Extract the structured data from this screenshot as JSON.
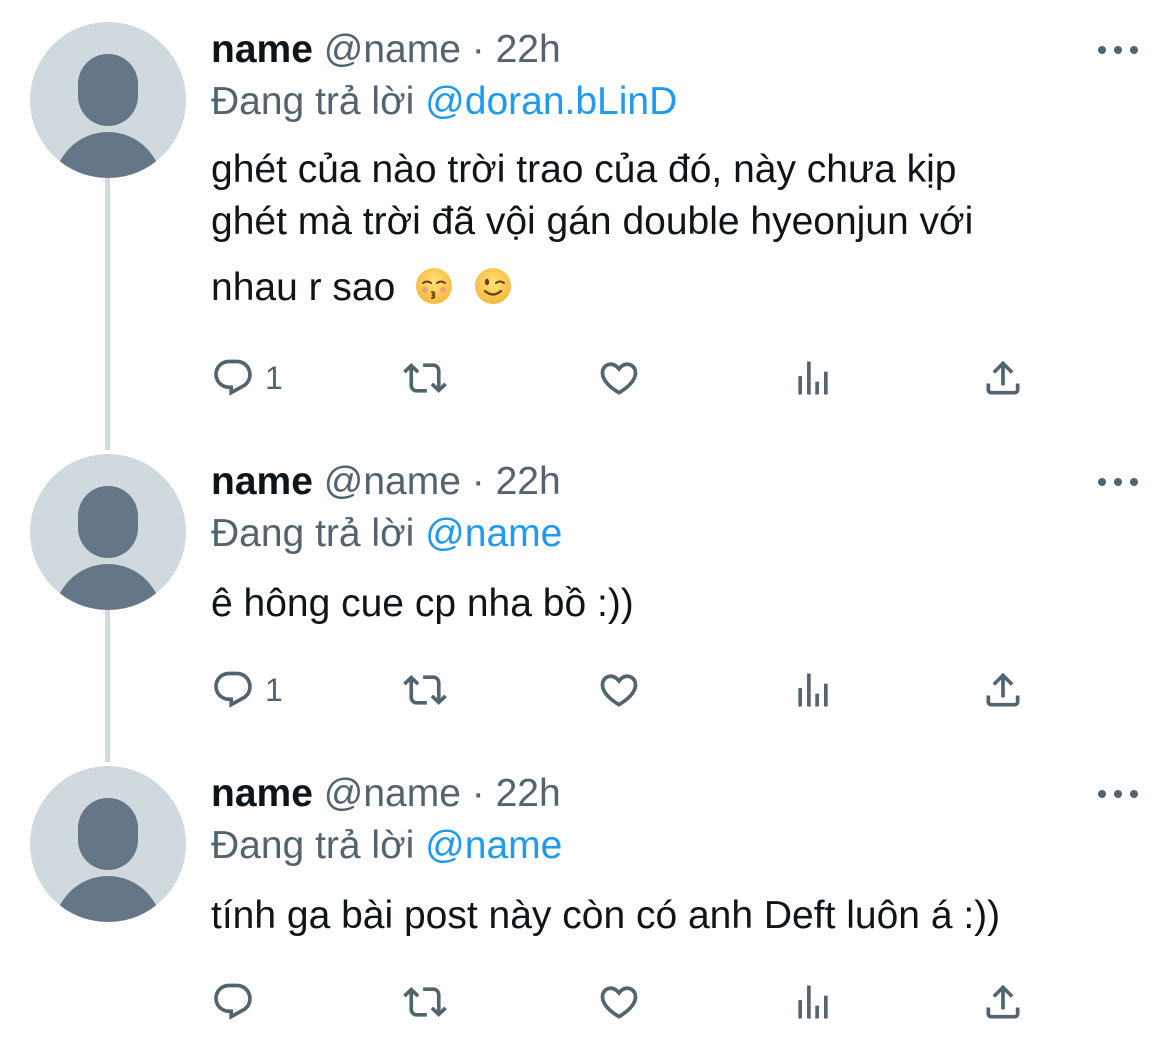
{
  "tweets": [
    {
      "display_name": "name",
      "handle": "@name",
      "dot": "·",
      "time": "22h",
      "reply_prefix": "Đang trả lời",
      "reply_to": "@doran.bLinD",
      "text_lines": [
        "ghét của nào trời trao của đó, này chưa kịp",
        "ghét mà trời đã vội gán double hyeonjun với",
        "nhau r sao"
      ],
      "emojis": [
        "kissing-closed-eyes-emoji",
        "winking-face-emoji"
      ],
      "reply_count": "1"
    },
    {
      "display_name": "name",
      "handle": "@name",
      "dot": "·",
      "time": "22h",
      "reply_prefix": "Đang trả lời",
      "reply_to": "@name",
      "text_lines": [
        "ê hông cue cp nha bồ :))"
      ],
      "reply_count": "1"
    },
    {
      "display_name": "name",
      "handle": "@name",
      "dot": "·",
      "time": "22h",
      "reply_prefix": "Đang trả lời",
      "reply_to": "@name",
      "text_lines": [
        "tính ga bài post này còn có anh Deft luôn á :))"
      ],
      "reply_count": ""
    }
  ],
  "icons": {
    "reply": "reply-icon",
    "retweet": "retweet-icon",
    "like": "heart-icon",
    "views": "analytics-icon",
    "share": "share-icon",
    "more": "more-icon"
  },
  "colors": {
    "text": "#0f1419",
    "secondary": "#536471",
    "mention": "#1d9bf0",
    "thread_line": "#cfd9de",
    "avatar_bg": "#cfd9de",
    "avatar_fg": "#657786"
  }
}
